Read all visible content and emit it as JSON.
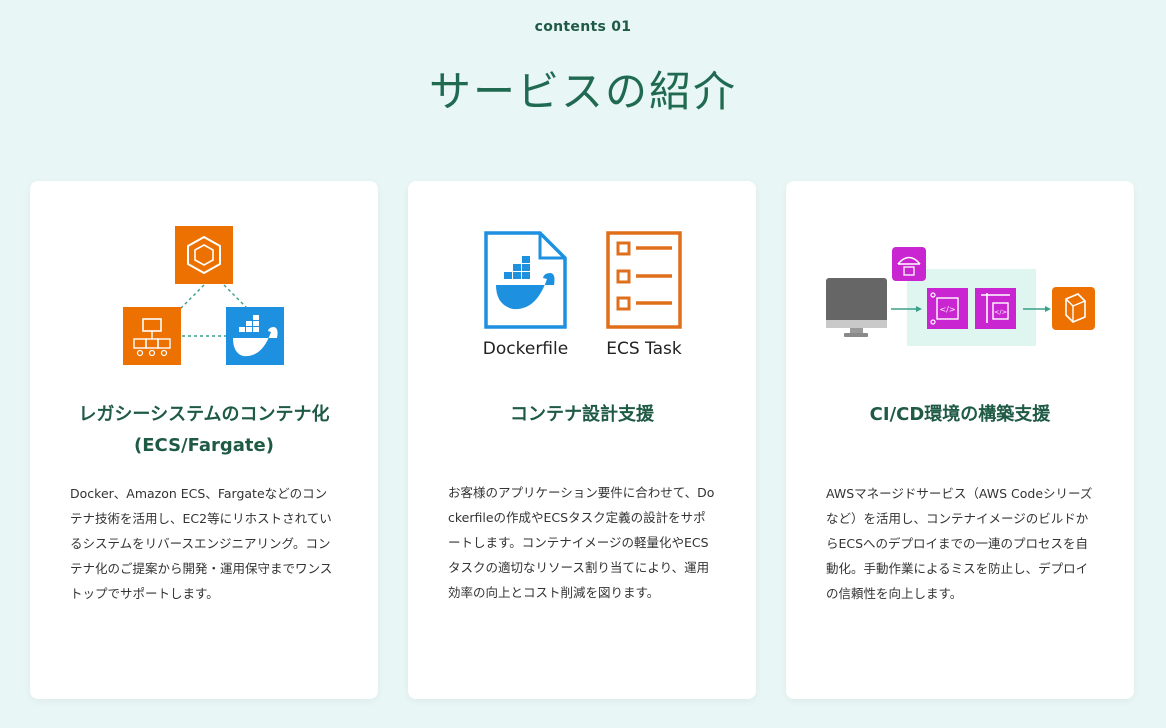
{
  "section": {
    "label": "contents 01",
    "title": "サービスの紹介"
  },
  "cards": [
    {
      "title_line1": "レガシーシステムのコンテナ化",
      "title_line2": "(ECS/Fargate)",
      "body": "Docker、Amazon ECS、Fargateなどのコンテナ技術を活用し、EC2等にリホストされているシステムをリバースエンジニアリング。コンテナ化のご提案から開発・運用保守までワンストップでサポートします。",
      "icons": [
        "ecs-icon",
        "fargate-icon",
        "docker-icon"
      ]
    },
    {
      "title_line1": "コンテナ設計支援",
      "body": "お客様のアプリケーション要件に合わせて、Dockerfileの作成やECSタスク定義の設計をサポートします。コンテナイメージの軽量化やECSタスクの適切なリソース割り当てにより、運用効率の向上とコスト削減を図ります。",
      "icon_labels": [
        "Dockerfile",
        "ECS Task"
      ],
      "icons": [
        "dockerfile-icon",
        "ecs-task-icon"
      ]
    },
    {
      "title_line1": "CI/CD環境の構築支援",
      "body": "AWSマネージドサービス（AWS Codeシリーズなど）を活用し、コンテナイメージのビルドからECSへのデプロイまでの一連のプロセスを自動化。手動作業によるミスを防止し、デプロイの信頼性を向上します。",
      "icons": [
        "monitor-icon",
        "codepipeline-icon",
        "codecommit-icon",
        "codebuild-icon",
        "ecs-icon"
      ]
    }
  ],
  "colors": {
    "background": "#e8f6f5",
    "heading": "#1f6a50",
    "aws_orange": "#ed7100",
    "docker_blue": "#1d91e0",
    "aws_magenta": "#c925d1"
  }
}
